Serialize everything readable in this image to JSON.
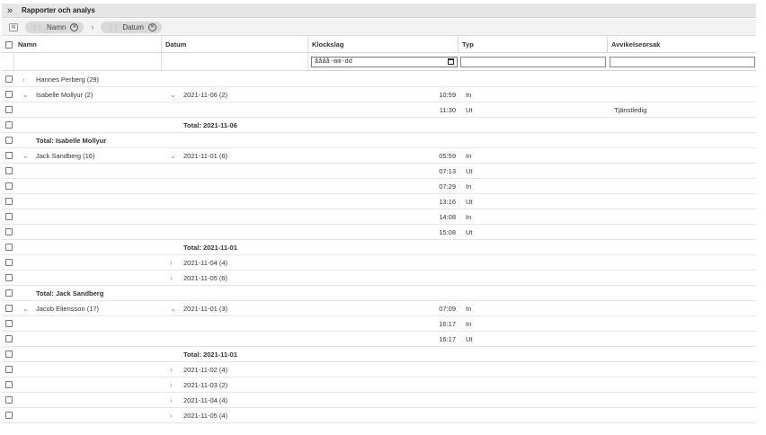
{
  "titlebar": {
    "expand_glyph": "»",
    "title": "Rapporter och analys"
  },
  "groupbar": {
    "icon": "group-panel-icon",
    "chips": [
      {
        "label": "Namn"
      },
      {
        "label": "Datum"
      }
    ],
    "separator": "›"
  },
  "columns": {
    "name": "Namn",
    "date": "Datum",
    "time": "Klockslag",
    "type": "Typ",
    "reason": "Avvikelseorsak"
  },
  "filters": {
    "date_placeholder": "åååå-mm-dd",
    "type_value": "",
    "reason_value": ""
  },
  "rows": [
    {
      "chev_name": "›",
      "name": "Hannes Perberg (29)",
      "chev_date": "",
      "date": "",
      "time": "",
      "type": "",
      "reason": "",
      "bold": false
    },
    {
      "chev_name": "⌄",
      "name": "Isabelle Mollyur (2)",
      "chev_date": "⌄",
      "date": "2021-11-06 (2)",
      "time": "10:59",
      "type": "In",
      "reason": "",
      "bold": false
    },
    {
      "chev_name": "",
      "name": "",
      "chev_date": "",
      "date": "",
      "time": "11:30",
      "type": "Ut",
      "reason": "Tjänstledig",
      "bold": false
    },
    {
      "chev_name": "",
      "name": "",
      "chev_date": "",
      "date": "Total: 2021-11-06",
      "time": "",
      "type": "",
      "reason": "",
      "bold": true
    },
    {
      "chev_name": "",
      "name": "Total: Isabelle Mollyur",
      "chev_date": "",
      "date": "",
      "time": "",
      "type": "",
      "reason": "",
      "bold": true
    },
    {
      "chev_name": "⌄",
      "name": "Jack Sandberg (16)",
      "chev_date": "⌄",
      "date": "2021-11-01 (6)",
      "time": "05:59",
      "type": "In",
      "reason": "",
      "bold": false
    },
    {
      "chev_name": "",
      "name": "",
      "chev_date": "",
      "date": "",
      "time": "07:13",
      "type": "Ut",
      "reason": "",
      "bold": false
    },
    {
      "chev_name": "",
      "name": "",
      "chev_date": "",
      "date": "",
      "time": "07:29",
      "type": "In",
      "reason": "",
      "bold": false
    },
    {
      "chev_name": "",
      "name": "",
      "chev_date": "",
      "date": "",
      "time": "13:16",
      "type": "Ut",
      "reason": "",
      "bold": false
    },
    {
      "chev_name": "",
      "name": "",
      "chev_date": "",
      "date": "",
      "time": "14:08",
      "type": "In",
      "reason": "",
      "bold": false
    },
    {
      "chev_name": "",
      "name": "",
      "chev_date": "",
      "date": "",
      "time": "15:08",
      "type": "Ut",
      "reason": "",
      "bold": false
    },
    {
      "chev_name": "",
      "name": "",
      "chev_date": "",
      "date": "Total: 2021-11-01",
      "time": "",
      "type": "",
      "reason": "",
      "bold": true
    },
    {
      "chev_name": "",
      "name": "",
      "chev_date": "›",
      "date": "2021-11-04 (4)",
      "time": "",
      "type": "",
      "reason": "",
      "bold": false
    },
    {
      "chev_name": "",
      "name": "",
      "chev_date": "›",
      "date": "2021-11-05 (6)",
      "time": "",
      "type": "",
      "reason": "",
      "bold": false
    },
    {
      "chev_name": "",
      "name": "Total: Jack Sandberg",
      "chev_date": "",
      "date": "",
      "time": "",
      "type": "",
      "reason": "",
      "bold": true
    },
    {
      "chev_name": "⌄",
      "name": "Jacob Eliensson (17)",
      "chev_date": "⌄",
      "date": "2021-11-01 (3)",
      "time": "07:09",
      "type": "In",
      "reason": "",
      "bold": false
    },
    {
      "chev_name": "",
      "name": "",
      "chev_date": "",
      "date": "",
      "time": "16:17",
      "type": "In",
      "reason": "",
      "bold": false
    },
    {
      "chev_name": "",
      "name": "",
      "chev_date": "",
      "date": "",
      "time": "16:17",
      "type": "Ut",
      "reason": "",
      "bold": false
    },
    {
      "chev_name": "",
      "name": "",
      "chev_date": "",
      "date": "Total: 2021-11-01",
      "time": "",
      "type": "",
      "reason": "",
      "bold": true
    },
    {
      "chev_name": "",
      "name": "",
      "chev_date": "›",
      "date": "2021-11-02 (4)",
      "time": "",
      "type": "",
      "reason": "",
      "bold": false
    },
    {
      "chev_name": "",
      "name": "",
      "chev_date": "›",
      "date": "2021-11-03 (2)",
      "time": "",
      "type": "",
      "reason": "",
      "bold": false
    },
    {
      "chev_name": "",
      "name": "",
      "chev_date": "›",
      "date": "2021-11-04 (4)",
      "time": "",
      "type": "",
      "reason": "",
      "bold": false
    },
    {
      "chev_name": "",
      "name": "",
      "chev_date": "›",
      "date": "2021-11-05 (4)",
      "time": "",
      "type": "",
      "reason": "",
      "bold": false
    }
  ]
}
